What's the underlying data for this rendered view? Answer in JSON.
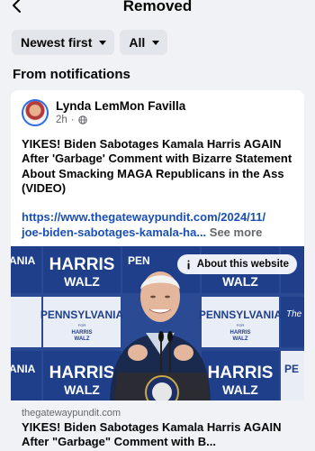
{
  "header": {
    "title": "Removed"
  },
  "filters": {
    "sort_label": "Newest first",
    "scope_label": "All"
  },
  "section": {
    "label": "From notifications"
  },
  "post": {
    "author": "Lynda LemMon Favilla",
    "time": "2h",
    "dot": "·",
    "text": "YIKES! Biden Sabotages Kamala Harris AGAIN After 'Garbage' Comment with Bizarre Statement About Smacking MAGA Republicans in the Ass (VIDEO)",
    "link_line1": "https://www.thegatewaypundit.com/2024/11/",
    "link_line2": "joe-biden-sabotages-kamala-ha...",
    "see_more": " See more",
    "about_label": "About this website",
    "preview_domain": "thegatewaypundit.com",
    "preview_title": "YIKES! Biden Sabotages Kamala Harris AGAIN After \"Garbage\" Comment with B..."
  },
  "photo_signage": {
    "harris": "HARRIS",
    "walz": "WALZ",
    "pennsylvania": "PENNSYLVANIA",
    "for": "FOR",
    "harris_small": "HARRIS",
    "walz_small": "WALZ",
    "ania": "ANIA",
    "pen": "PEN",
    "pe": "PE",
    "the": "The"
  },
  "colors": {
    "link": "#1a4fb8",
    "chip_bg": "#e2e5e9",
    "page_bg": "#f0f2f5",
    "sign_blue": "#1f3f8a"
  },
  "icons": {
    "back": "chevron-left-icon",
    "sort_caret": "caret-down-icon",
    "globe": "globe-icon",
    "info": "info-icon"
  }
}
